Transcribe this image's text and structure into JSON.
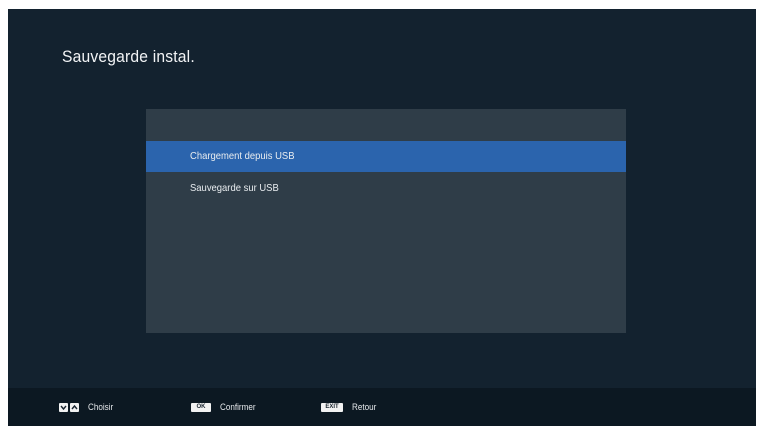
{
  "header": {
    "title": "Sauvegarde instal."
  },
  "menu": {
    "items": [
      {
        "label": "Chargement depuis USB",
        "selected": true
      },
      {
        "label": "Sauvegarde sur USB",
        "selected": false
      }
    ]
  },
  "footer": {
    "hints": [
      {
        "keys": [
          "chevron-down-icon",
          "chevron-up-icon"
        ],
        "label": "Choisir"
      },
      {
        "key_label": "OK",
        "label": "Confirmer"
      },
      {
        "key_label": "EXIT",
        "label": "Retour"
      }
    ]
  },
  "colors": {
    "background": "#13222f",
    "panel": "#2f3d48",
    "selection": "#2b64ad",
    "footer": "#0c1822"
  }
}
